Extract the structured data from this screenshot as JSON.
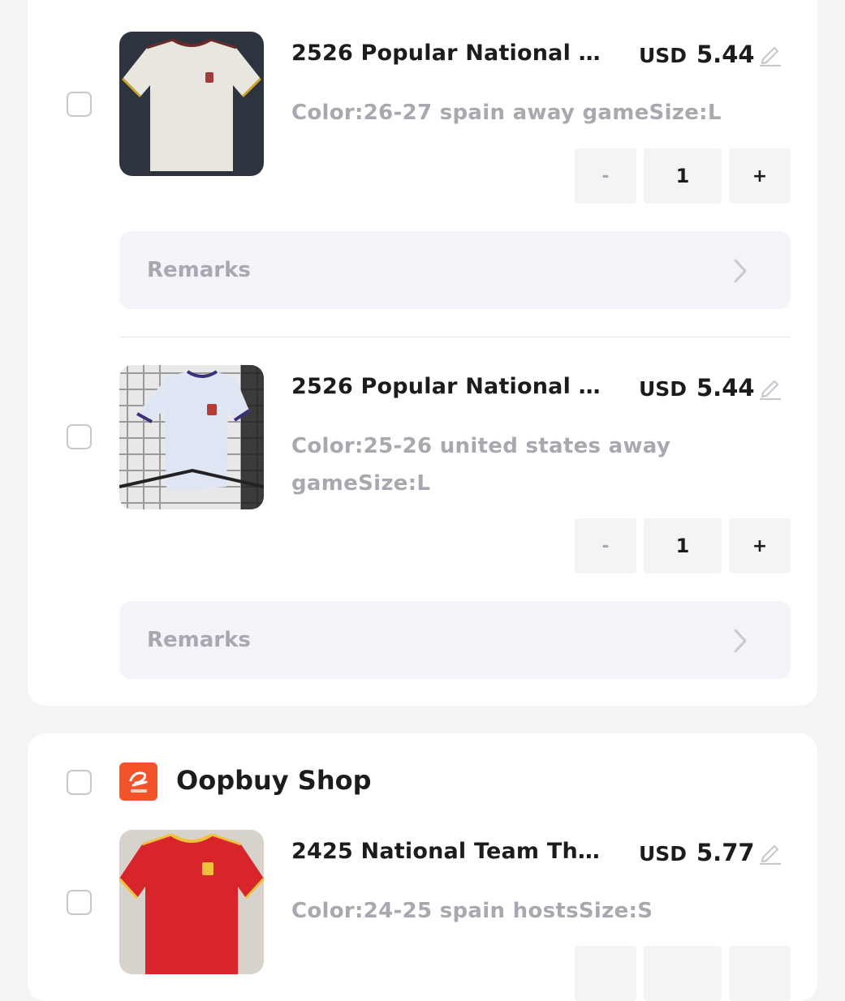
{
  "items": [
    {
      "title": "2526 Popular National Te...",
      "currency": "USD",
      "price": "5.44",
      "spec_lines": [
        "Color:26-27 spain away gameSize:L"
      ],
      "quantity": "1",
      "minus_label": "-",
      "plus_label": "+",
      "remarks_label": "Remarks"
    },
    {
      "title": "2526 Popular National Te...",
      "currency": "USD",
      "price": "5.44",
      "spec_lines": [
        "Color:25-26 united states away",
        "gameSize:L"
      ],
      "quantity": "1",
      "minus_label": "-",
      "plus_label": "+",
      "remarks_label": "Remarks"
    },
    {
      "title": "2425 National Team Thai ...",
      "currency": "USD",
      "price": "5.77",
      "spec_lines": [
        "Color:24-25 spain hostsSize:S"
      ]
    }
  ],
  "shop": {
    "name": "Oopbuy Shop",
    "logo_icon": "alibaba-1688-logo",
    "logo_color": "#f4532a"
  },
  "colors": {
    "background": "#f3f4f6",
    "card": "#ffffff",
    "muted_text": "#a8a9b0",
    "primary_text": "#1c1c1e"
  }
}
